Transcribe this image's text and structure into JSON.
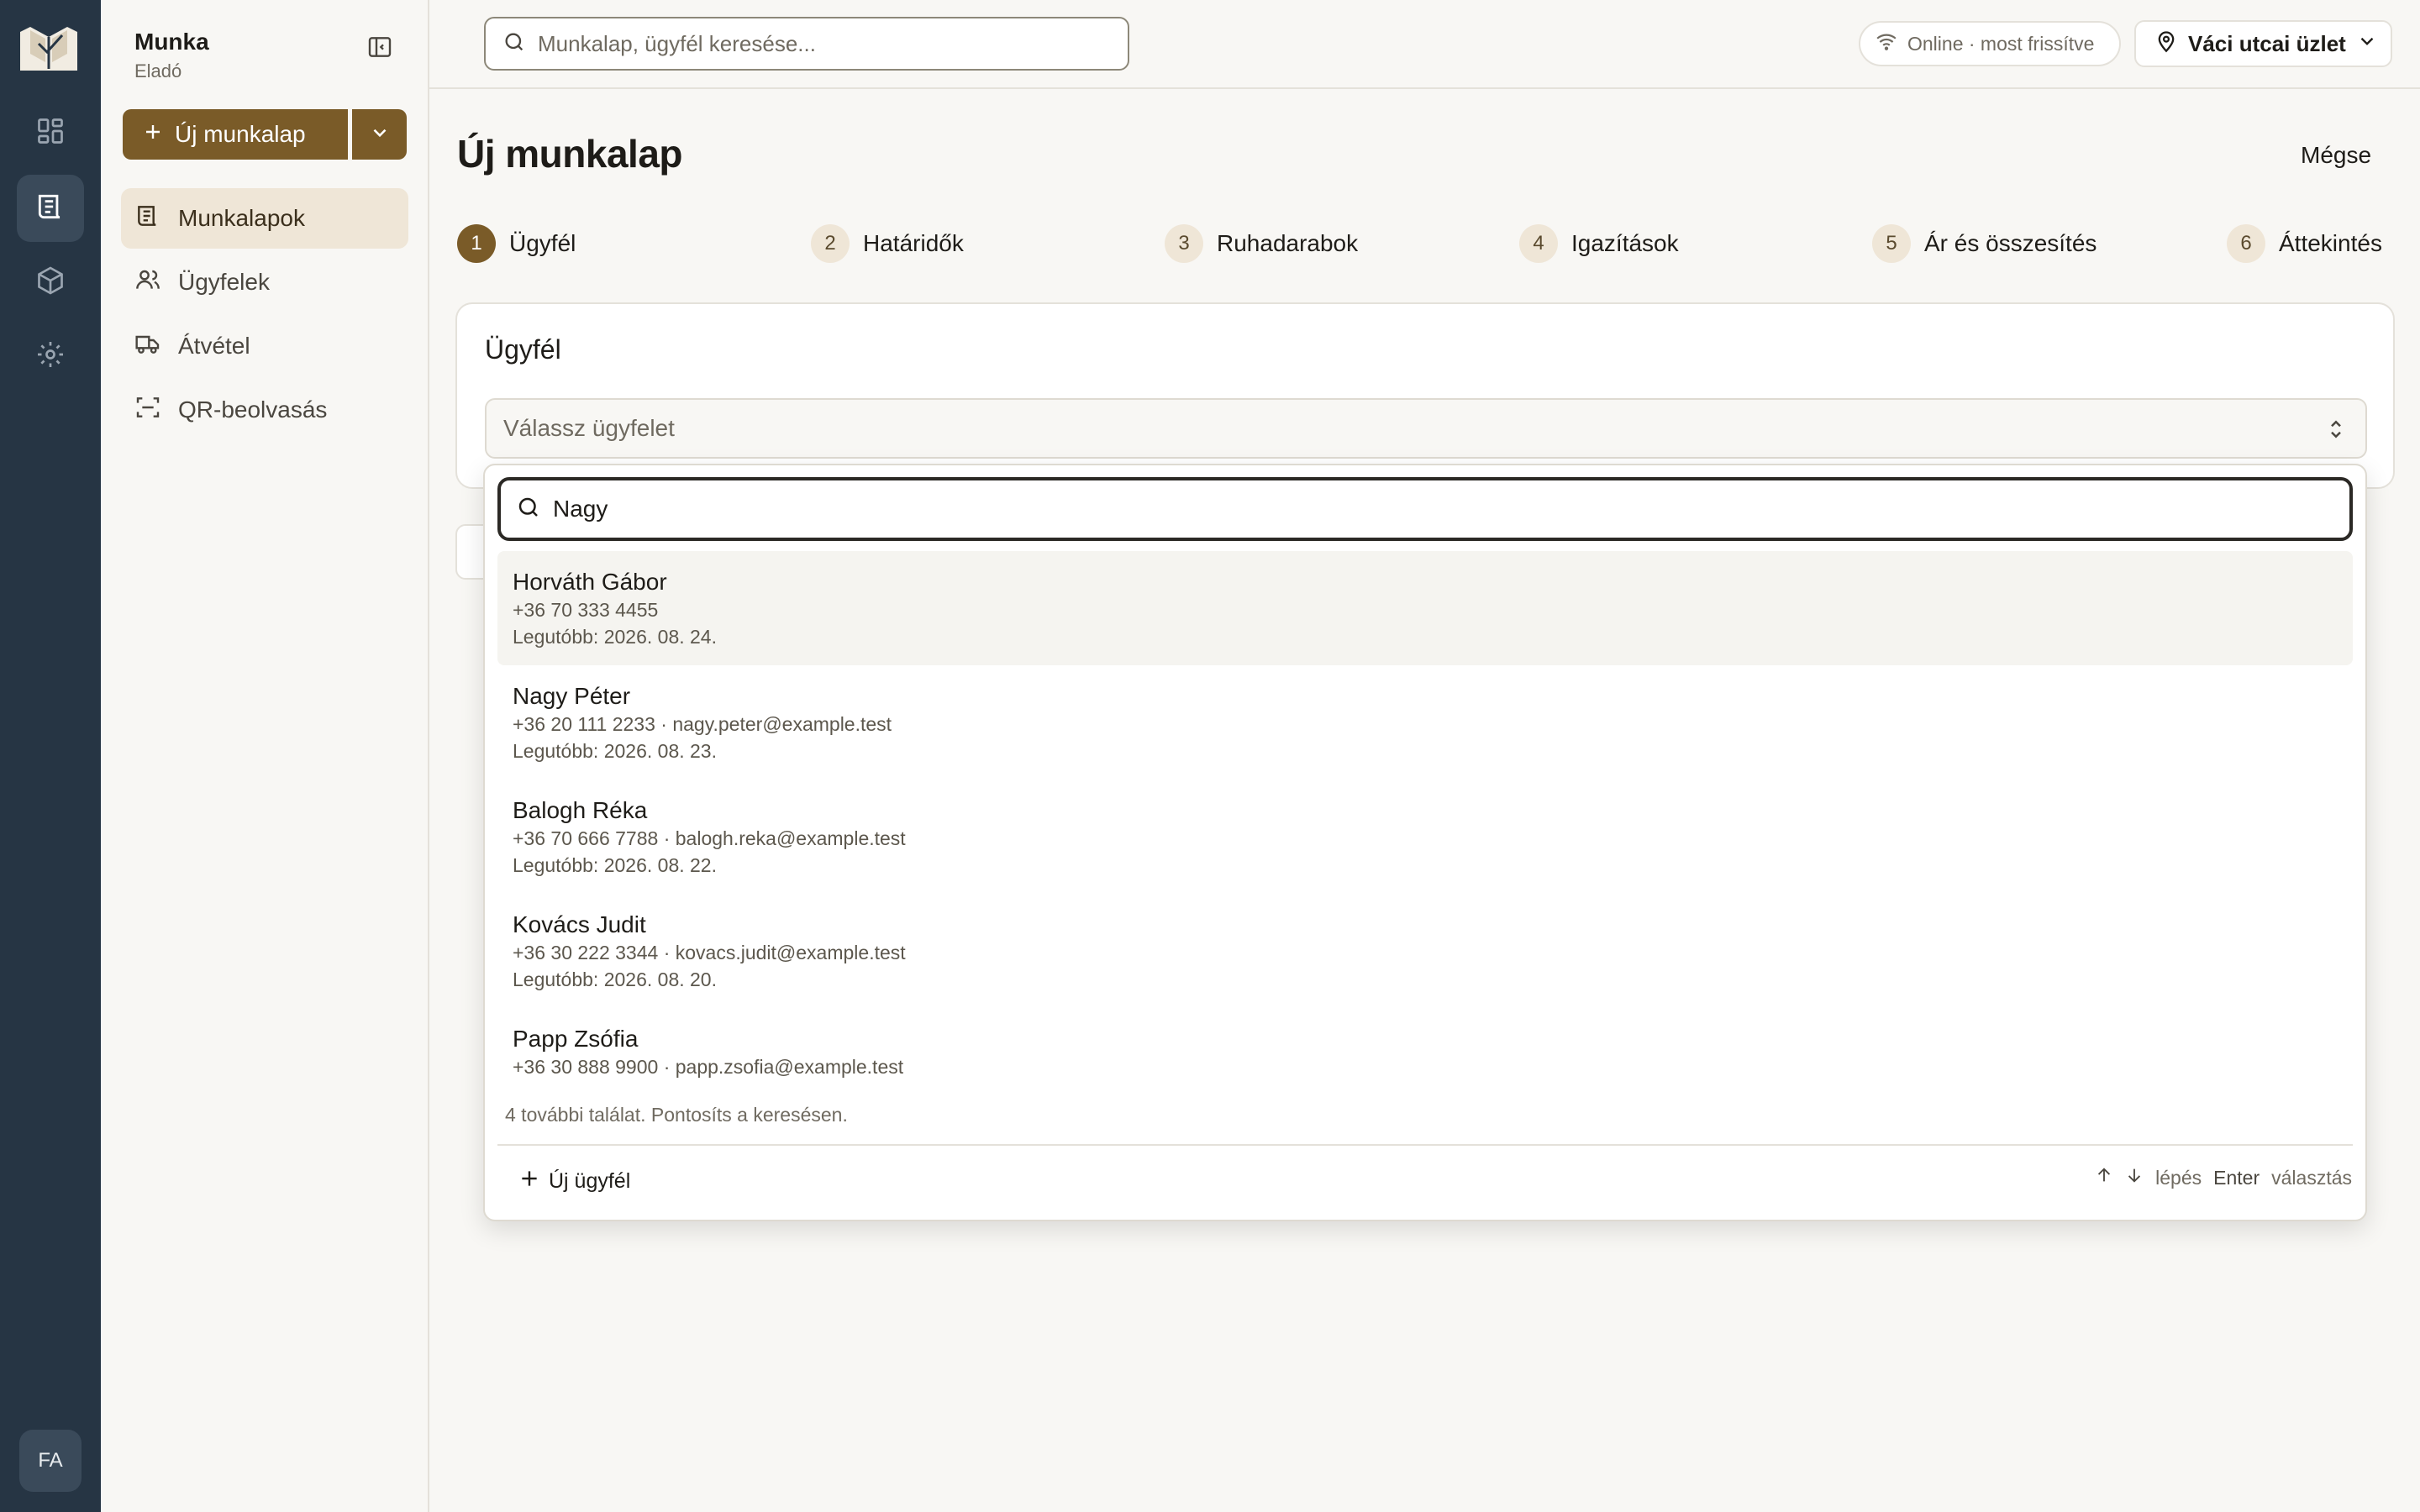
{
  "rail": {
    "items": [
      {
        "icon": "dashboard-icon",
        "active": false
      },
      {
        "icon": "worksheet-icon",
        "active": true
      },
      {
        "icon": "package-icon",
        "active": false
      },
      {
        "icon": "gear-icon",
        "active": false
      }
    ],
    "avatar": "FA"
  },
  "sidebar": {
    "workspace": "Munka",
    "role": "Eladó",
    "new_button": "Új munkalap",
    "items": [
      {
        "label": "Munkalapok",
        "icon": "worksheet-icon",
        "active": true
      },
      {
        "label": "Ügyfelek",
        "icon": "users-icon",
        "active": false
      },
      {
        "label": "Átvétel",
        "icon": "truck-icon",
        "active": false
      },
      {
        "label": "QR-beolvasás",
        "icon": "qr-scan-icon",
        "active": false
      }
    ]
  },
  "topbar": {
    "search_placeholder": "Munkalap, ügyfél keresése...",
    "status": "Online · most frissítve",
    "store": "Váci utcai üzlet"
  },
  "page": {
    "title": "Új munkalap",
    "cancel": "Mégse",
    "steps": [
      {
        "num": "1",
        "label": "Ügyfél",
        "active": true
      },
      {
        "num": "2",
        "label": "Határidők",
        "active": false
      },
      {
        "num": "3",
        "label": "Ruhadarabok",
        "active": false
      },
      {
        "num": "4",
        "label": "Igazítások",
        "active": false
      },
      {
        "num": "5",
        "label": "Ár és összesítés",
        "active": false
      },
      {
        "num": "6",
        "label": "Áttekintés",
        "active": false
      }
    ]
  },
  "customer": {
    "title": "Ügyfél",
    "select_placeholder": "Válassz ügyfelet"
  },
  "dropdown": {
    "query": "Nagy",
    "results": [
      {
        "name": "Horváth Gábor",
        "contact": "+36 70 333 4455",
        "last": "Legutóbb: 2026. 08. 24."
      },
      {
        "name": "Nagy Péter",
        "contact": "+36 20 111 2233 · nagy.peter@example.test",
        "last": "Legutóbb: 2026. 08. 23."
      },
      {
        "name": "Balogh Réka",
        "contact": "+36 70 666 7788 · balogh.reka@example.test",
        "last": "Legutóbb: 2026. 08. 22."
      },
      {
        "name": "Kovács Judit",
        "contact": "+36 30 222 3344 · kovacs.judit@example.test",
        "last": "Legutóbb: 2026. 08. 20."
      },
      {
        "name": "Papp Zsófia",
        "contact": "+36 30 888 9900 · papp.zsofia@example.test",
        "last": ""
      }
    ],
    "more_text": "4 további találat. Pontosíts a keresésen.",
    "new_client": "Új ügyfél",
    "hint_step": "lépés",
    "hint_enter": "Enter",
    "hint_select": "választás"
  }
}
